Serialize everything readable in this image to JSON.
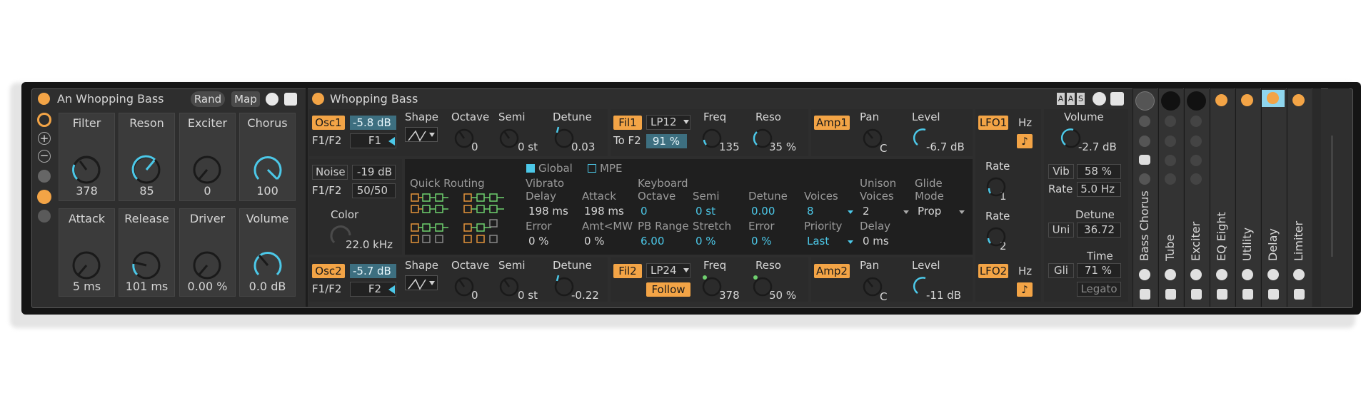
{
  "rack": {
    "title": "An Whopping Bass",
    "rand_label": "Rand",
    "map_label": "Map",
    "macros": [
      {
        "label": "Filter",
        "value": "378",
        "blue": false
      },
      {
        "label": "Reson",
        "value": "85",
        "blue": true
      },
      {
        "label": "Exciter",
        "value": "0",
        "blue": false
      },
      {
        "label": "Chorus",
        "value": "100",
        "blue": true
      },
      {
        "label": "Attack",
        "value": "5 ms",
        "blue": false
      },
      {
        "label": "Release",
        "value": "101 ms",
        "blue": false
      },
      {
        "label": "Driver",
        "value": "0.00 %",
        "blue": false
      },
      {
        "label": "Volume",
        "value": "0.0 dB",
        "blue": true
      }
    ]
  },
  "synth": {
    "title": "Whopping Bass",
    "osc1": {
      "label": "Osc1",
      "level": "-5.8 dB",
      "f1f2_label": "F1/F2",
      "f1f2_value": "F1",
      "shape_label": "Shape",
      "octave_label": "Octave",
      "octave_value": "0",
      "semi_label": "Semi",
      "semi_value": "0 st",
      "detune_label": "Detune",
      "detune_value": "0.03"
    },
    "osc2": {
      "label": "Osc2",
      "level": "-5.7 dB",
      "f1f2_label": "F1/F2",
      "f1f2_value": "F2",
      "shape_label": "Shape",
      "octave_label": "Octave",
      "octave_value": "0",
      "semi_label": "Semi",
      "semi_value": "0 st",
      "detune_label": "Detune",
      "detune_value": "-0.22"
    },
    "noise": {
      "label": "Noise",
      "level": "-19 dB",
      "f1f2_label": "F1/F2",
      "f1f2_value": "50/50",
      "color_label": "Color",
      "color_value": "22.0 kHz"
    },
    "fil1": {
      "label": "Fil1",
      "type": "LP12",
      "tof2_label": "To F2",
      "tof2_value": "91 %",
      "freq_label": "Freq",
      "freq_value": "135",
      "reso_label": "Reso",
      "reso_value": "35 %"
    },
    "fil2": {
      "label": "Fil2",
      "type": "LP24",
      "follow_label": "Follow",
      "freq_label": "Freq",
      "freq_value": "378",
      "reso_label": "Reso",
      "reso_value": "50 %"
    },
    "amp1": {
      "label": "Amp1",
      "pan_label": "Pan",
      "pan_value": "C",
      "level_label": "Level",
      "level_value": "-6.7 dB"
    },
    "amp2": {
      "label": "Amp2",
      "pan_label": "Pan",
      "pan_value": "C",
      "level_label": "Level",
      "level_value": "-11 dB"
    },
    "lfo1": {
      "label": "LFO1",
      "hz": "Hz",
      "rate_label": "Rate",
      "rate_value": "1",
      "rate2_label": "Rate",
      "rate2_value": "2"
    },
    "lfo2": {
      "label": "LFO2",
      "hz": "Hz"
    },
    "center": {
      "global_label": "Global",
      "mpe_label": "MPE",
      "quick_routing_label": "Quick Routing",
      "vibrato_label": "Vibrato",
      "keyboard_label": "Keyboard",
      "unison_label": "Unison",
      "glide_label": "Glide",
      "row1_labels": [
        "Delay",
        "Attack",
        "Octave",
        "Semi",
        "Detune",
        "Voices",
        "Voices",
        "Mode"
      ],
      "row1_values": [
        "198 ms",
        "198 ms",
        "0",
        "0 st",
        "0.00",
        "8",
        "2",
        "Prop"
      ],
      "row2_labels": [
        "Error",
        "Amt<MW",
        "PB Range",
        "Stretch",
        "Error",
        "Priority",
        "Delay"
      ],
      "row2_values": [
        "0 %",
        "0 %",
        "6.00",
        "0 %",
        "0 %",
        "Last",
        "0 ms"
      ]
    },
    "right": {
      "volume_label": "Volume",
      "volume_value": "-2.7 dB",
      "vib_label": "Vib",
      "vib_value": "58 %",
      "rate_label": "Rate",
      "rate_value": "5.0 Hz",
      "detune_label": "Detune",
      "uni_label": "Uni",
      "uni_value": "36.72",
      "time_label": "Time",
      "gli_label": "Gli",
      "gli_value": "71 %",
      "legato_label": "Legato",
      "aas": [
        "A",
        "A",
        "S"
      ]
    }
  },
  "chain": [
    {
      "name": "Bass Chorus"
    },
    {
      "name": "Tube"
    },
    {
      "name": "Exciter"
    },
    {
      "name": "EQ Eight"
    },
    {
      "name": "Utility"
    },
    {
      "name": "Delay"
    },
    {
      "name": "Limiter"
    }
  ],
  "colors": {
    "orange": "#f3a446",
    "blue": "#4cc8e8",
    "panel": "#2b2b2b"
  }
}
